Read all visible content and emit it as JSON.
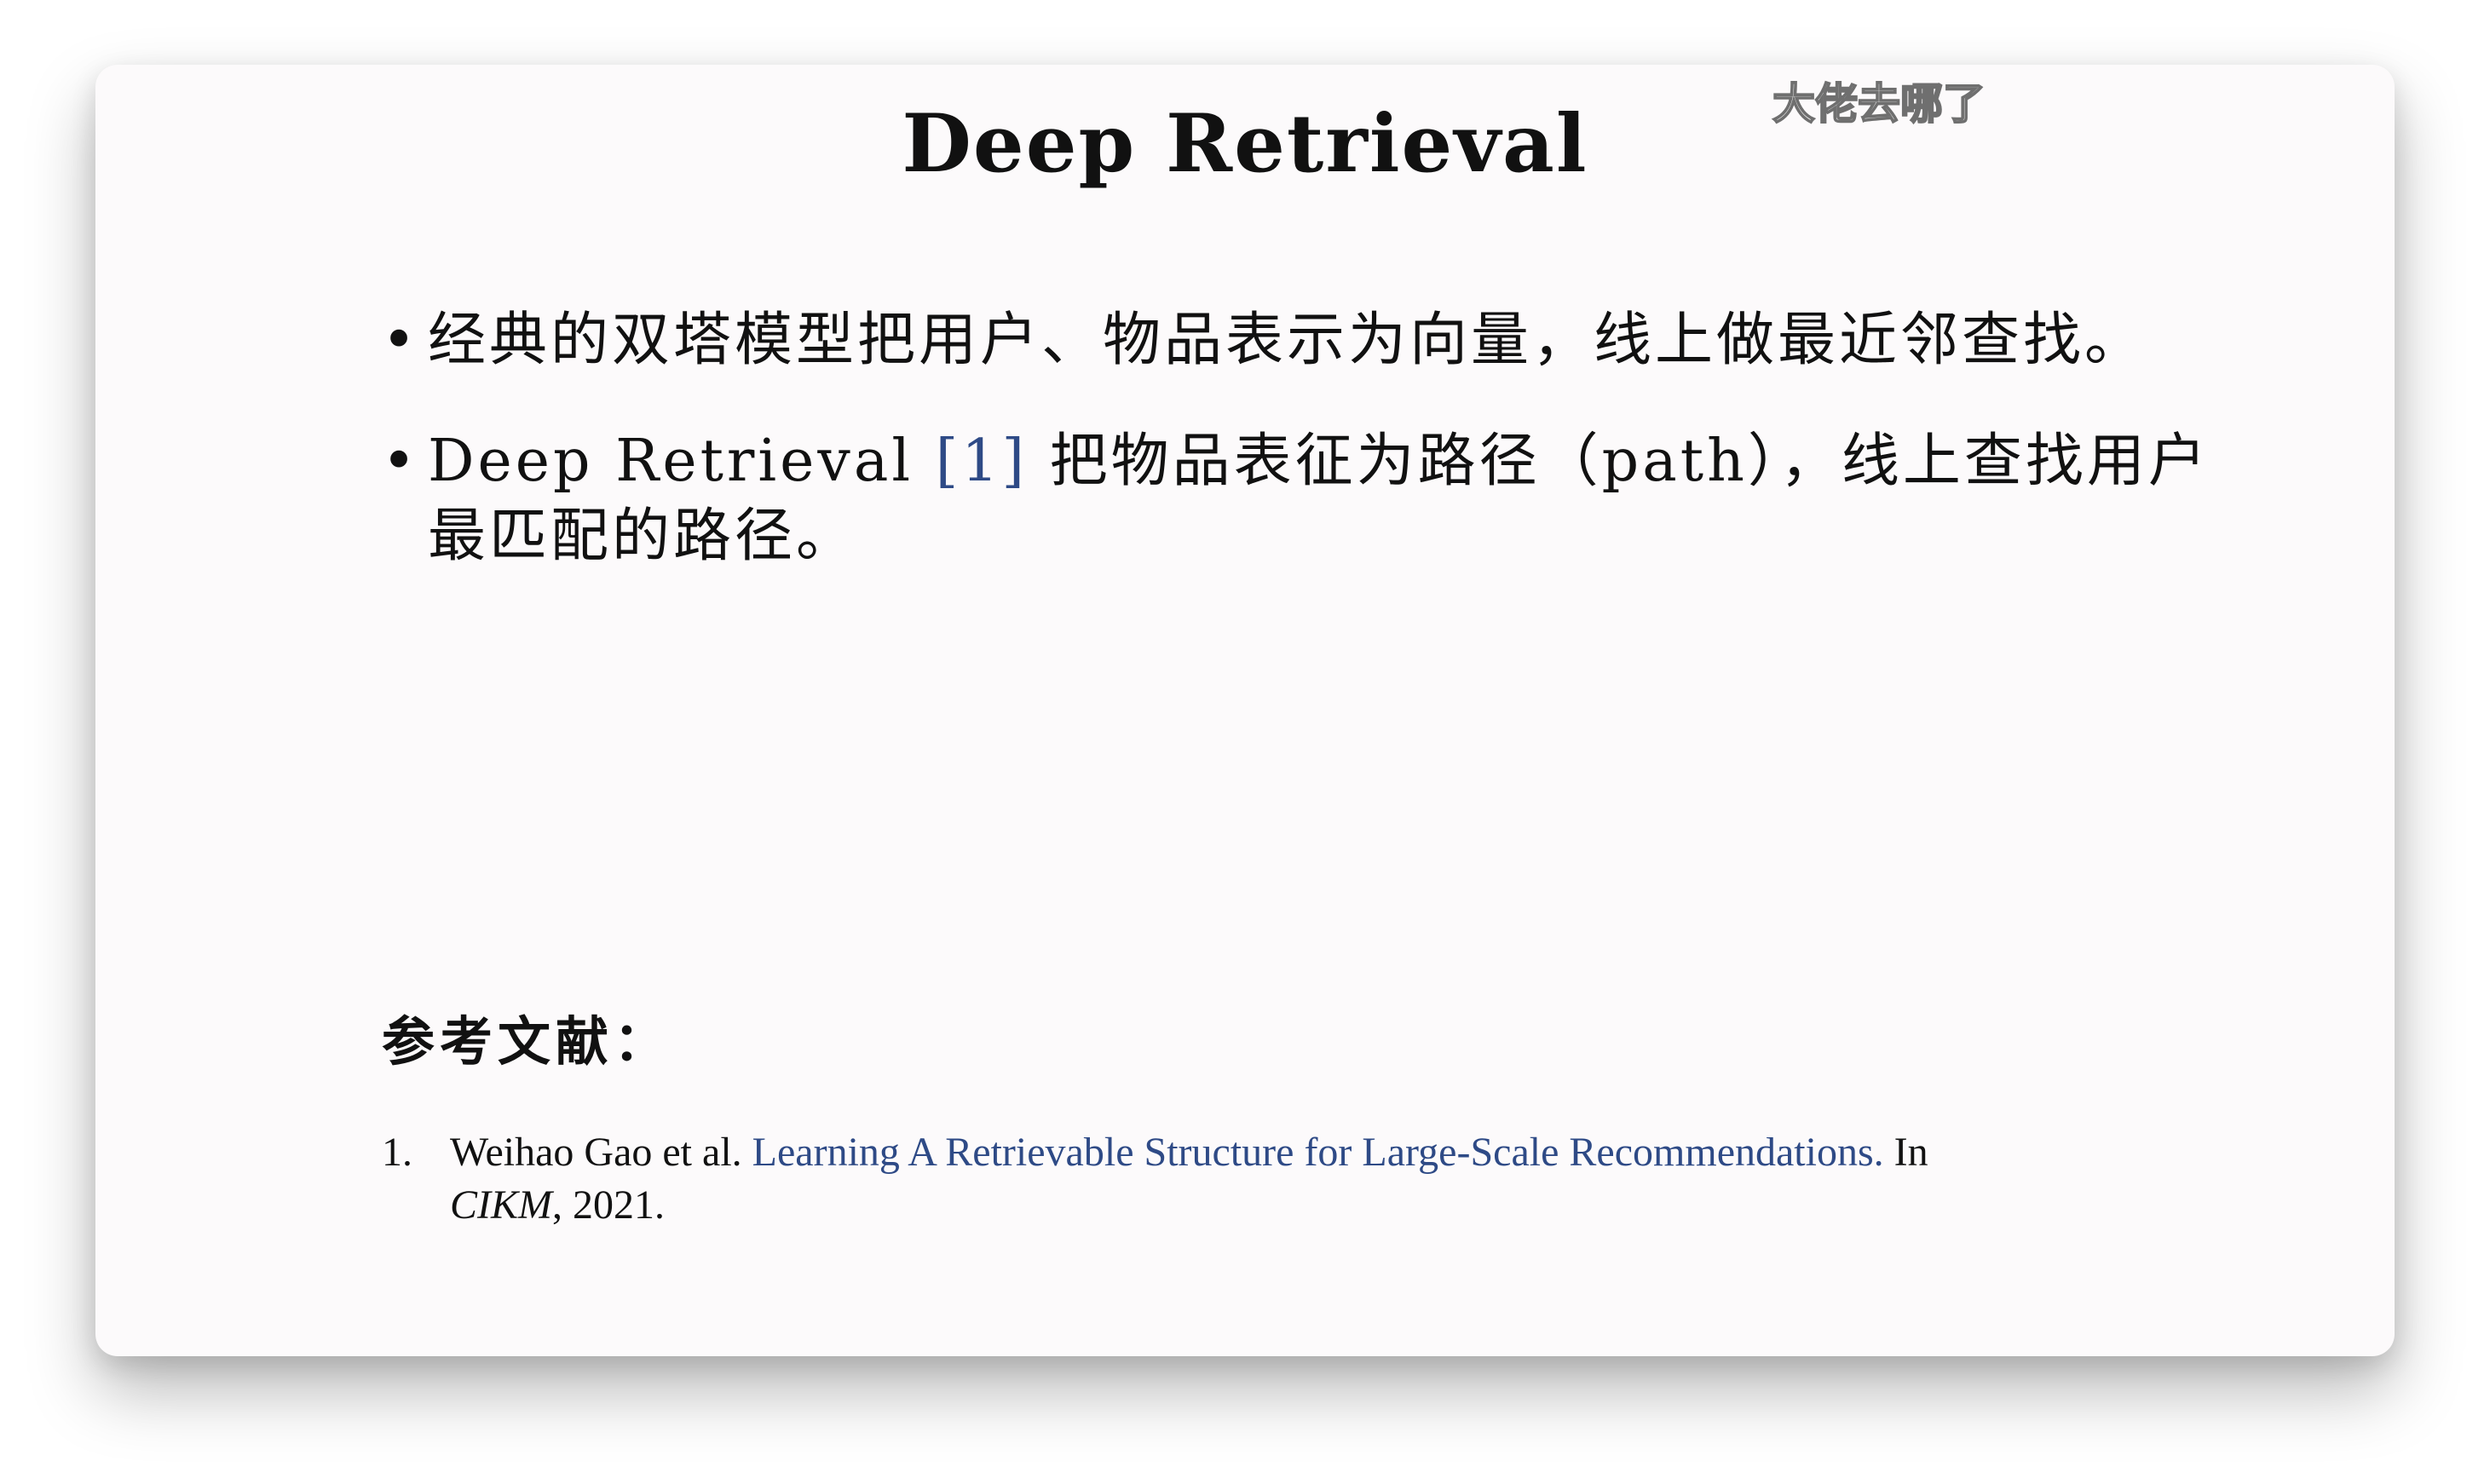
{
  "watermark": "大佬去哪了",
  "slide": {
    "title": "Deep Retrieval",
    "bullets": [
      {
        "marker": "•",
        "text": "经典的双塔模型把用户、物品表示为向量，线上做最近邻查找。"
      },
      {
        "marker": "•",
        "text_before": "Deep Retrieval ",
        "citation": "[1]",
        "text_after": " 把物品表征为路径（path），线上查找用户最匹配的路径。"
      }
    ],
    "references_heading": "参考文献：",
    "references": [
      {
        "number": "1.",
        "authors": "Weihao Gao et al. ",
        "title": "Learning A Retrievable Structure for Large-Scale Recommendations.",
        "in_text": " In ",
        "venue": "CIKM",
        "year": ", 2021."
      }
    ]
  },
  "colors": {
    "text": "#111111",
    "link": "#2e4a86",
    "slide_background": "#fcfafb"
  }
}
